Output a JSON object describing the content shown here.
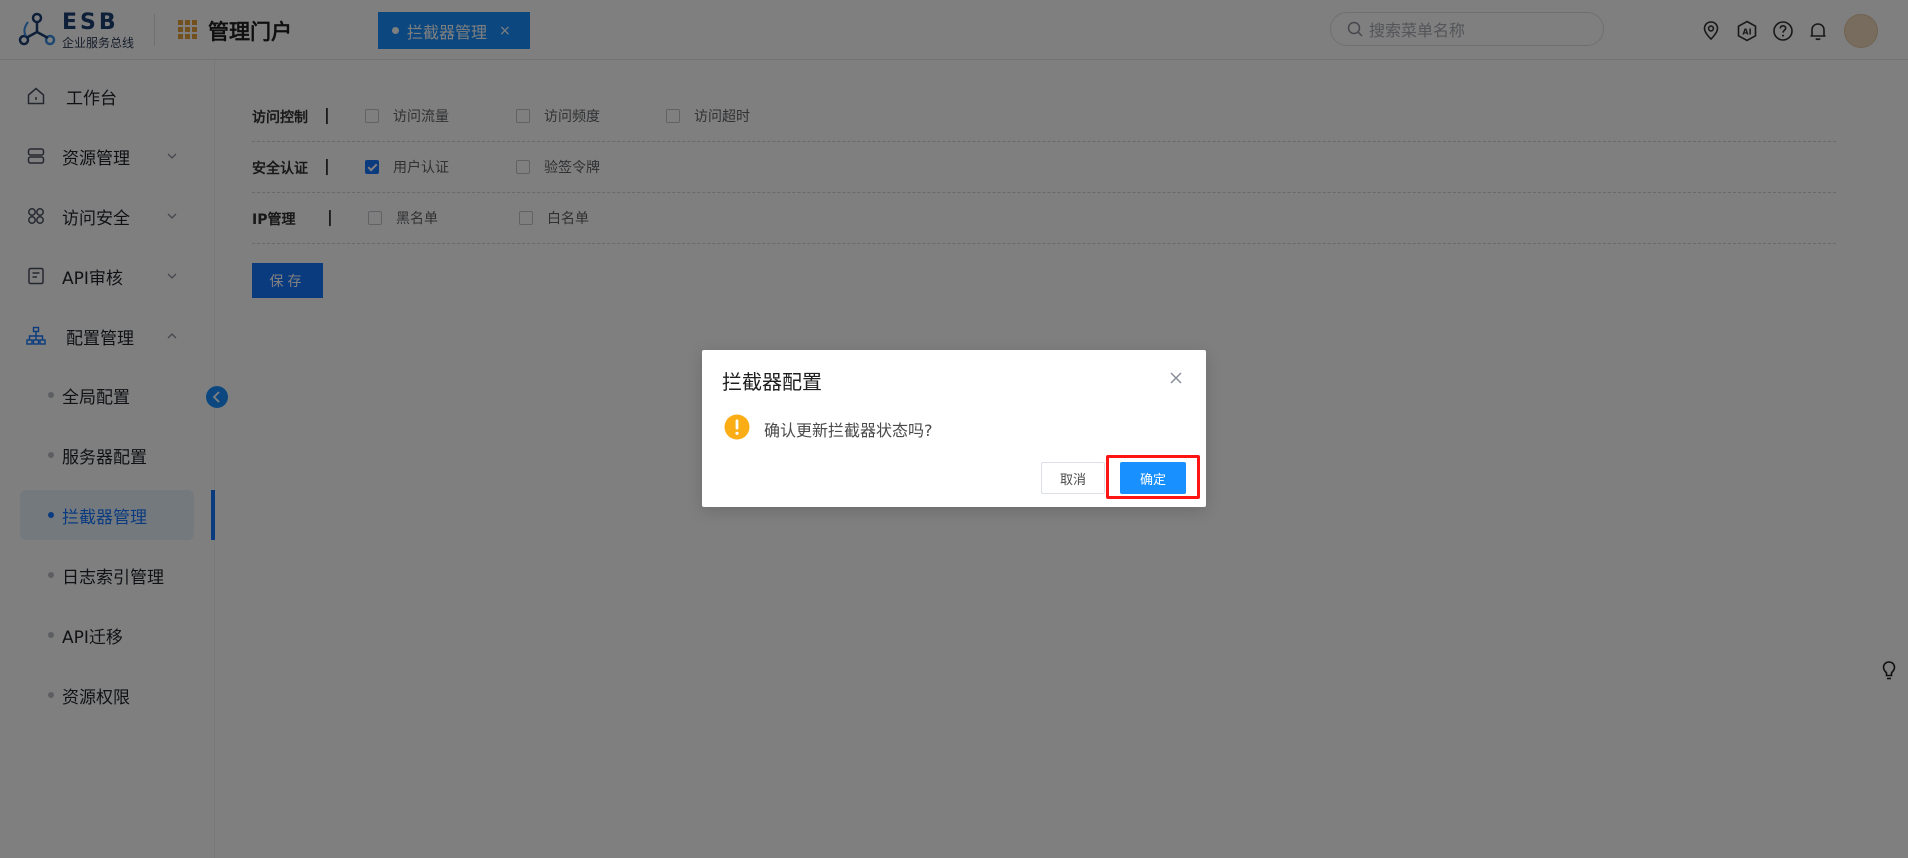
{
  "header": {
    "logo_text": "ESB",
    "logo_subtitle": "企业服务总线",
    "portal_title": "管理门户",
    "active_tab": "拦截器管理",
    "tab_close": "×",
    "search_placeholder": "搜索菜单名称",
    "icons": [
      "location-icon",
      "ai-icon",
      "help-icon",
      "bell-icon",
      "avatar"
    ]
  },
  "sidebar": {
    "items": [
      {
        "label": "工作台",
        "icon": "home-icon"
      },
      {
        "label": "资源管理",
        "icon": "database-icon",
        "expandable": true
      },
      {
        "label": "访问安全",
        "icon": "grid-icon",
        "expandable": true
      },
      {
        "label": "API审核",
        "icon": "document-icon",
        "expandable": true
      },
      {
        "label": "配置管理",
        "icon": "sitemap-icon",
        "expanded": true
      }
    ],
    "sub_items": [
      {
        "label": "全局配置"
      },
      {
        "label": "服务器配置"
      },
      {
        "label": "拦截器管理",
        "active": true
      },
      {
        "label": "日志索引管理"
      },
      {
        "label": "API迁移"
      },
      {
        "label": "资源权限"
      }
    ]
  },
  "main": {
    "rows": [
      {
        "label": "访问控制",
        "sep": "|",
        "options": [
          {
            "text": "访问流量",
            "checked": false
          },
          {
            "text": "访问频度",
            "checked": false
          },
          {
            "text": "访问超时",
            "checked": false
          }
        ]
      },
      {
        "label": "安全认证",
        "sep": "|",
        "options": [
          {
            "text": "用户认证",
            "checked": true
          },
          {
            "text": "验签令牌",
            "checked": false
          }
        ]
      },
      {
        "label": "IP管理",
        "sep": "|",
        "options": [
          {
            "text": "黑名单",
            "checked": false
          },
          {
            "text": "白名单",
            "checked": false
          }
        ]
      }
    ],
    "save_label": "保存"
  },
  "dialog": {
    "title": "拦截器配置",
    "message": "确认更新拦截器状态吗?",
    "cancel_label": "取消",
    "confirm_label": "确定"
  },
  "colors": {
    "primary": "#1890ff",
    "highlight": "#ff1414",
    "warning": "#faad14"
  }
}
